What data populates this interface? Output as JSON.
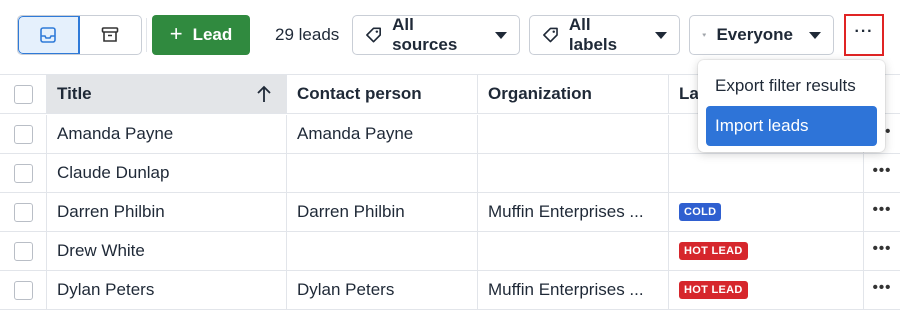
{
  "toolbar": {
    "lead_count": "29 leads",
    "add_label": "Lead",
    "filters": {
      "sources": "All sources",
      "labels": "All labels",
      "owner": "Everyone"
    },
    "more_label": "···"
  },
  "table": {
    "headers": [
      "Title",
      "Contact person",
      "Organization",
      "La"
    ],
    "rows": [
      {
        "title": "Amanda Payne",
        "contact": "Amanda Payne",
        "org": "",
        "label": "",
        "label_color": ""
      },
      {
        "title": "Claude Dunlap",
        "contact": "",
        "org": "",
        "label": "",
        "label_color": ""
      },
      {
        "title": "Darren Philbin",
        "contact": "Darren Philbin",
        "org": "Muffin Enterprises ...",
        "label": "COLD",
        "label_color": "#2f5fd0"
      },
      {
        "title": "Drew White",
        "contact": "",
        "org": "",
        "label": "HOT LEAD",
        "label_color": "#d6262c"
      },
      {
        "title": "Dylan Peters",
        "contact": "Dylan Peters",
        "org": "Muffin Enterprises ...",
        "label": "HOT LEAD",
        "label_color": "#d6262c"
      }
    ],
    "row_action": "•••"
  },
  "menu": {
    "items": [
      "Export filter results",
      "Import leads"
    ],
    "highlighted_index": 1
  },
  "colors": {
    "accent": "#2e74d8",
    "add_button": "#308a3f",
    "highlight_box": "#e02424"
  }
}
